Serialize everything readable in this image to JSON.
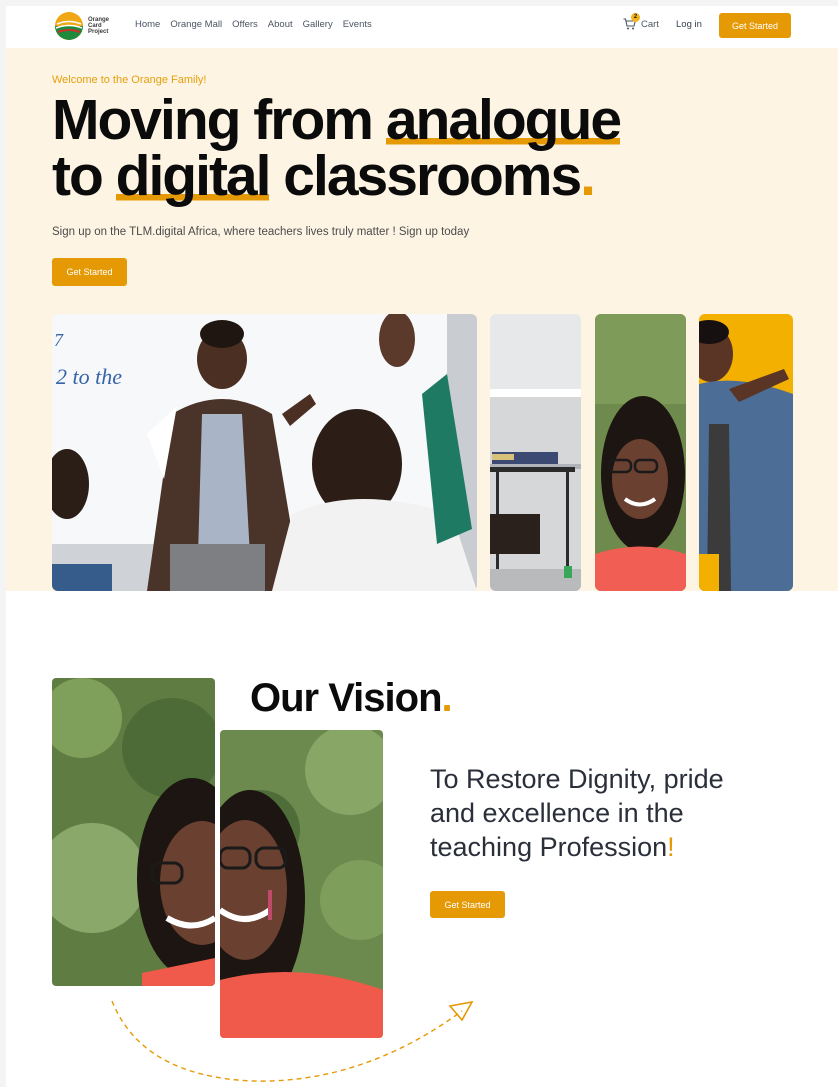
{
  "nav": {
    "logo_text": "Orange Card Project",
    "links": [
      "Home",
      "Orange Mall",
      "Offers",
      "About",
      "Gallery",
      "Events"
    ],
    "cart_label": "Cart",
    "cart_count": "2",
    "login_label": "Log in",
    "cta_label": "Get Started"
  },
  "hero": {
    "kicker": "Welcome to the Orange Family!",
    "title_part1": "Moving from ",
    "title_ul1": "analogue",
    "title_part2": "to ",
    "title_ul2": "digital",
    "title_part3": " classrooms",
    "title_dot": ".",
    "subtitle": "Sign up on the TLM.digital Africa, where teachers lives truly matter ! Sign up today",
    "cta_label": "Get Started",
    "board_text_1": "2 to the",
    "board_text_2": "7"
  },
  "vision": {
    "title": "Our Vision",
    "title_dot": ".",
    "statement": "To Restore Dignity, pride and excellence in the teaching Profession",
    "statement_mark": "!",
    "cta_label": "Get Started"
  },
  "colors": {
    "accent": "#e59a05",
    "hero_bg": "#fdf4e4",
    "text_dark": "#0b0b0b"
  }
}
